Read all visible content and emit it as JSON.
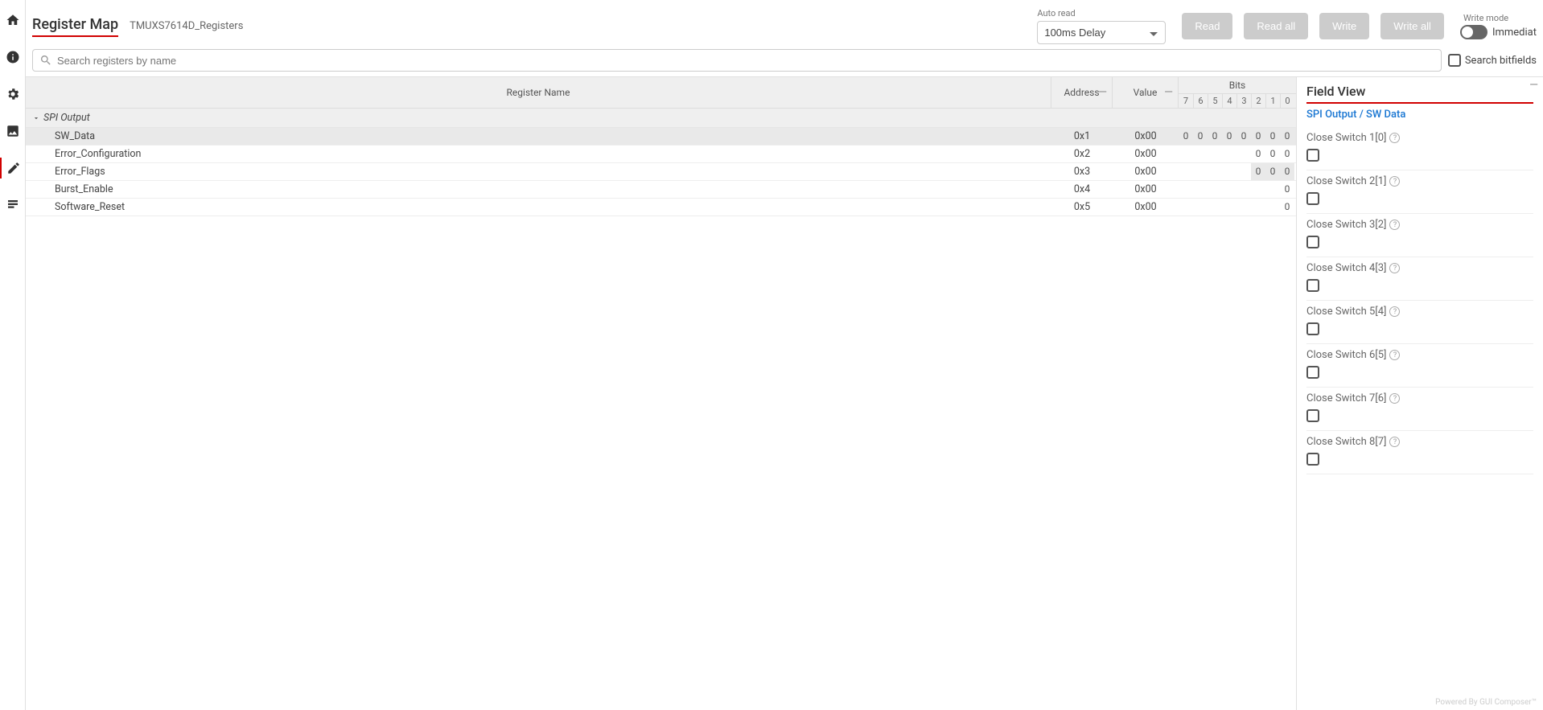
{
  "sidebar": {
    "items": [
      {
        "name": "home-icon"
      },
      {
        "name": "info-icon"
      },
      {
        "name": "settings-icon"
      },
      {
        "name": "image-icon"
      },
      {
        "name": "edit-icon"
      },
      {
        "name": "notes-icon"
      }
    ]
  },
  "header": {
    "title": "Register Map",
    "device": "TMUXS7614D_Registers",
    "auto_read_label": "Auto read",
    "auto_read_value": "100ms Delay",
    "buttons": {
      "read": "Read",
      "read_all": "Read all",
      "write": "Write",
      "write_all": "Write all"
    },
    "write_mode_label": "Write mode",
    "write_mode_value": "Immediat"
  },
  "search": {
    "placeholder": "Search registers by name",
    "bitfields_label": "Search bitfields"
  },
  "table": {
    "columns": {
      "name": "Register Name",
      "address": "Address",
      "value": "Value",
      "bits": "Bits"
    },
    "bit_headers": [
      "7",
      "6",
      "5",
      "4",
      "3",
      "2",
      "1",
      "0"
    ],
    "group": "SPI Output",
    "rows": [
      {
        "name": "SW_Data",
        "address": "0x1",
        "value": "0x00",
        "bits": [
          "0",
          "0",
          "0",
          "0",
          "0",
          "0",
          "0",
          "0"
        ],
        "selected": true,
        "bitstyle": "full"
      },
      {
        "name": "Error_Configuration",
        "address": "0x2",
        "value": "0x00",
        "bits": [
          "",
          "",
          "",
          "",
          "",
          "0",
          "0",
          "0"
        ],
        "bitstyle": "none"
      },
      {
        "name": "Error_Flags",
        "address": "0x3",
        "value": "0x00",
        "bits": [
          "",
          "",
          "",
          "",
          "",
          "0",
          "0",
          "0"
        ],
        "bitstyle": "partial"
      },
      {
        "name": "Burst_Enable",
        "address": "0x4",
        "value": "0x00",
        "bits": [
          "",
          "",
          "",
          "",
          "",
          "",
          "",
          "0"
        ],
        "bitstyle": "none"
      },
      {
        "name": "Software_Reset",
        "address": "0x5",
        "value": "0x00",
        "bits": [
          "",
          "",
          "",
          "",
          "",
          "",
          "",
          "0"
        ],
        "bitstyle": "none"
      }
    ]
  },
  "fieldview": {
    "title": "Field View",
    "breadcrumb": "SPI Output / SW Data",
    "fields": [
      {
        "label": "Close Switch 1[0]"
      },
      {
        "label": "Close Switch 2[1]"
      },
      {
        "label": "Close Switch 3[2]"
      },
      {
        "label": "Close Switch 4[3]"
      },
      {
        "label": "Close Switch 5[4]"
      },
      {
        "label": "Close Switch 6[5]"
      },
      {
        "label": "Close Switch 7[6]"
      },
      {
        "label": "Close Switch 8[7]"
      }
    ]
  },
  "footer": "Powered By GUI Composer™"
}
